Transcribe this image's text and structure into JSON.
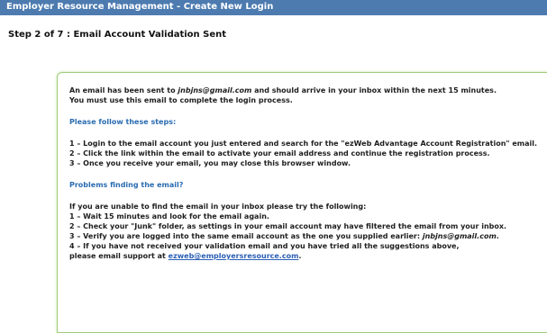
{
  "header": {
    "title": "Employer Resource Management  -  Create New Login"
  },
  "step": {
    "label": "Step 2 of 7 : Email Account Validation Sent"
  },
  "message": {
    "intro_prefix": "An email has been sent to ",
    "email": "jnbjns@gmail.com",
    "intro_suffix": " and should arrive in your inbox within the next 15 minutes.",
    "intro_line2": "You must use this email to complete the login process."
  },
  "steps_section": {
    "heading": "Please follow these steps:",
    "items": [
      "1 – Login to the email account you just entered and search for the \"ezWeb Advantage Account Registration\" email.",
      "2 – Click the link within the email to activate your email address and continue the registration process.",
      "3 – Once you receive your email, you may close this browser window."
    ]
  },
  "problems_section": {
    "heading": "Problems finding the email?",
    "intro": "If you are unable to find the email in your inbox please try the following:",
    "items": [
      "1 – Wait 15 minutes and look for the email again.",
      "2 – Check your \"Junk\" folder, as settings in your email account may have filtered the email from your inbox."
    ],
    "item3_prefix": "3 – Verify you are logged into the same email account as the one you supplied earlier: ",
    "item3_email": "jnbjns@gmail.com",
    "item3_suffix": ".",
    "item4_line1": "4 – If you have not received your validation email and you have tried all the suggestions above,",
    "item4_line2_prefix": "please email support at ",
    "support_email": "ezweb@employersresource.com",
    "item4_line2_suffix": "."
  }
}
